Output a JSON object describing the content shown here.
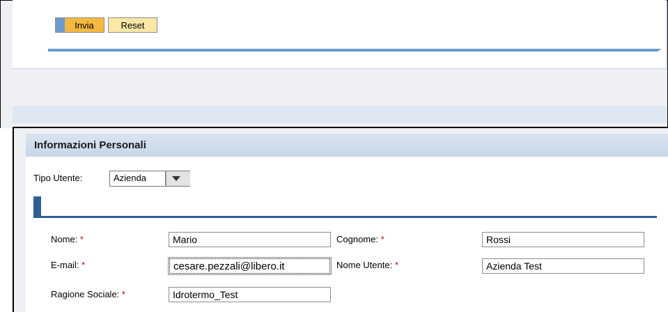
{
  "toolbar": {
    "submit_label": "Invia",
    "reset_label": "Reset"
  },
  "section": {
    "title": "Informazioni Personali"
  },
  "user_type": {
    "label": "Tipo Utente:",
    "selected": "Azienda"
  },
  "form": {
    "required_mark": "*",
    "first_name": {
      "label": "Nome:",
      "value": "Mario"
    },
    "last_name": {
      "label": "Cognome:",
      "value": "Rossi"
    },
    "email": {
      "label": "E-mail:",
      "value": "cesare.pezzali@libero.it"
    },
    "username": {
      "label": "Nome Utente:",
      "value": "Azienda Test"
    },
    "company_name": {
      "label": "Ragione Sociale:",
      "value": "Idrotermo_Test"
    }
  },
  "colors": {
    "accent_blue": "#2e5e93",
    "button_orange": "#f5b942",
    "required_red": "#d00000"
  }
}
